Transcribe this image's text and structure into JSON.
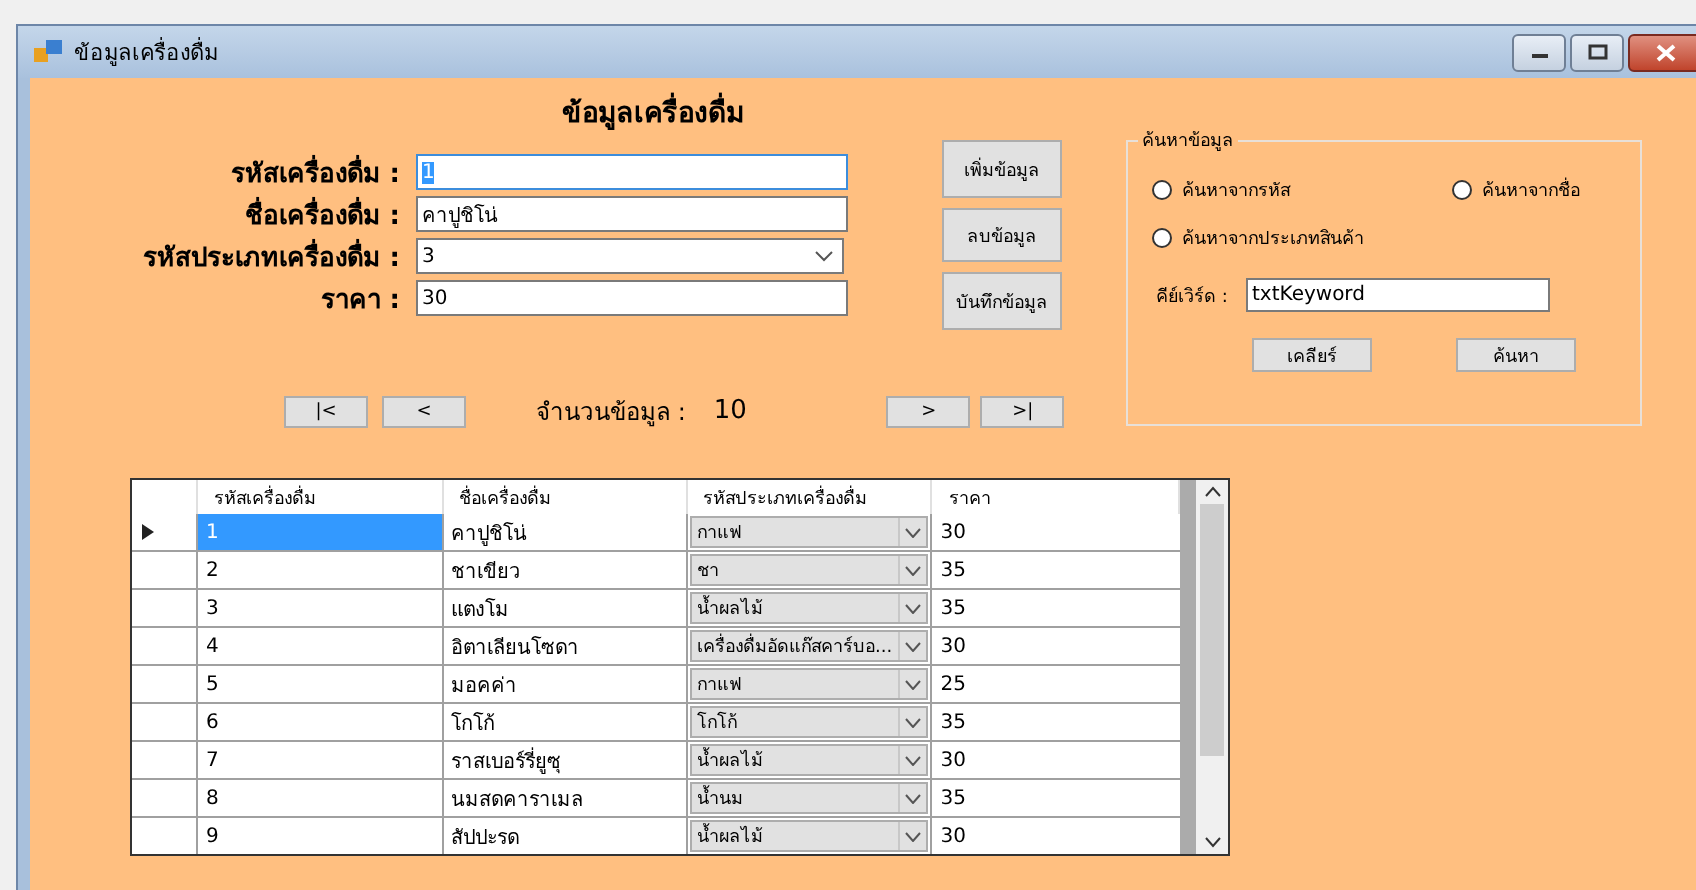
{
  "window": {
    "title": "ข้อมูลเครื่องดื่ม"
  },
  "form": {
    "heading": "ข้อมูลเครื่องดื่ม",
    "fields": [
      {
        "kind": "text",
        "label": "รหัสเครื่องดื่ม :",
        "value": "1",
        "focused": true
      },
      {
        "kind": "text",
        "label": "ชื่อเครื่องดื่ม :",
        "value": "คาปูชิโน่",
        "focused": false
      },
      {
        "kind": "combo",
        "label": "รหัสประเภทเครื่องดื่ม :",
        "value": "3",
        "focused": false
      },
      {
        "kind": "text",
        "label": "ราคา :",
        "value": "30",
        "focused": false
      }
    ],
    "buttons": [
      "เพิ่มข้อมูล",
      "ลบข้อมูล",
      "บันทึกข้อมูล"
    ]
  },
  "navigation": {
    "first": "|<",
    "previous": "<",
    "count_label": "จำนวนข้อมูล :",
    "count": "10",
    "next": ">",
    "last": ">|"
  },
  "search": {
    "title": "ค้นหาข้อมูล",
    "options": [
      {
        "label": "ค้นหาจากรหัส",
        "selected": false
      },
      {
        "label": "ค้นหาจากชื่อ",
        "selected": false
      },
      {
        "label": "ค้นหาจากประเภทสินค้า",
        "selected": false
      }
    ],
    "keyword_label": "คีย์เวิร์ด :",
    "keyword": "txtKeyword",
    "buttons": [
      "เคลียร์",
      "ค้นหา"
    ]
  },
  "table": {
    "columns": [
      "รหัสเครื่องดื่ม",
      "ชื่อเครื่องดื่ม",
      "รหัสประเภทเครื่องดื่ม",
      "ราคา"
    ],
    "rows": [
      {
        "id": "1",
        "name": "คาปูชิโน่",
        "type": "กาแฟ",
        "price": "30",
        "selected": true
      },
      {
        "id": "2",
        "name": "ชาเขียว",
        "type": "ชา",
        "price": "35",
        "selected": false
      },
      {
        "id": "3",
        "name": "แตงโม",
        "type": "น้ำผลไม้",
        "price": "35",
        "selected": false
      },
      {
        "id": "4",
        "name": "อิตาเลียนโซดา",
        "type": "เครื่องดื่มอัดแก๊สคาร์บอ...",
        "price": "30",
        "selected": false
      },
      {
        "id": "5",
        "name": "มอคค่า",
        "type": "กาแฟ",
        "price": "25",
        "selected": false
      },
      {
        "id": "6",
        "name": "โกโก้",
        "type": "โกโก้",
        "price": "35",
        "selected": false
      },
      {
        "id": "7",
        "name": "ราสเบอร์รี่ยูซุ",
        "type": "น้ำผลไม้",
        "price": "30",
        "selected": false
      },
      {
        "id": "8",
        "name": "นมสดคาราเมล",
        "type": "น้ำนม",
        "price": "35",
        "selected": false
      },
      {
        "id": "9",
        "name": "สัปปะรด",
        "type": "น้ำผลไม้",
        "price": "30",
        "selected": false
      }
    ]
  }
}
